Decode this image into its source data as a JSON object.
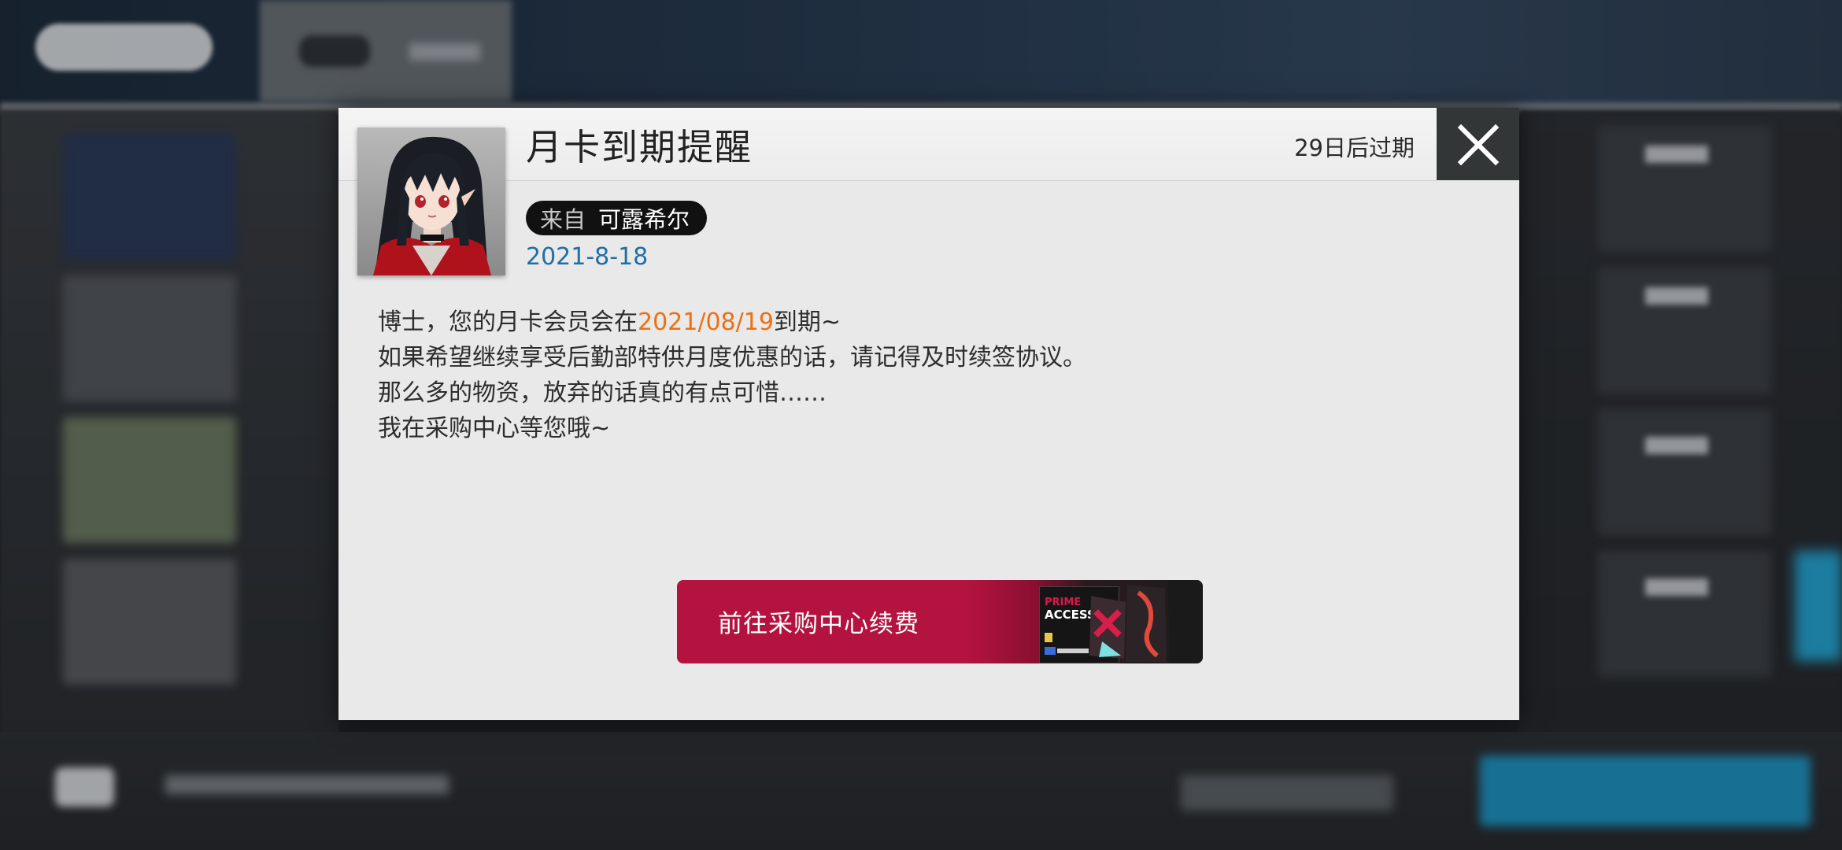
{
  "dialog": {
    "title": "月卡到期提醒",
    "expiry": "29日后过期",
    "sender_prefix": "来自",
    "sender_name": "可露希尔",
    "date": "2021-8-18",
    "body": {
      "line1_before": "博士，您的月卡会员会在",
      "line1_highlight": "2021/08/19",
      "line1_after": "到期~",
      "line2": "如果希望继续享受后勤部特供月度优惠的话，请记得及时续签协议。",
      "line3": "那么多的物资，放弃的话真的有点可惜……",
      "line4": "我在采购中心等您哦~"
    },
    "renew_button_label": "前往采购中心续费",
    "prime_card_title": "PRIME",
    "prime_card_subtitle": "ACCESS"
  },
  "icons": {
    "close": "close-icon",
    "avatar": "closure-portrait"
  },
  "colors": {
    "highlight": "#ee6f12",
    "date": "#1e6fa3",
    "button": "#b4133f",
    "close_bg": "#333637"
  }
}
